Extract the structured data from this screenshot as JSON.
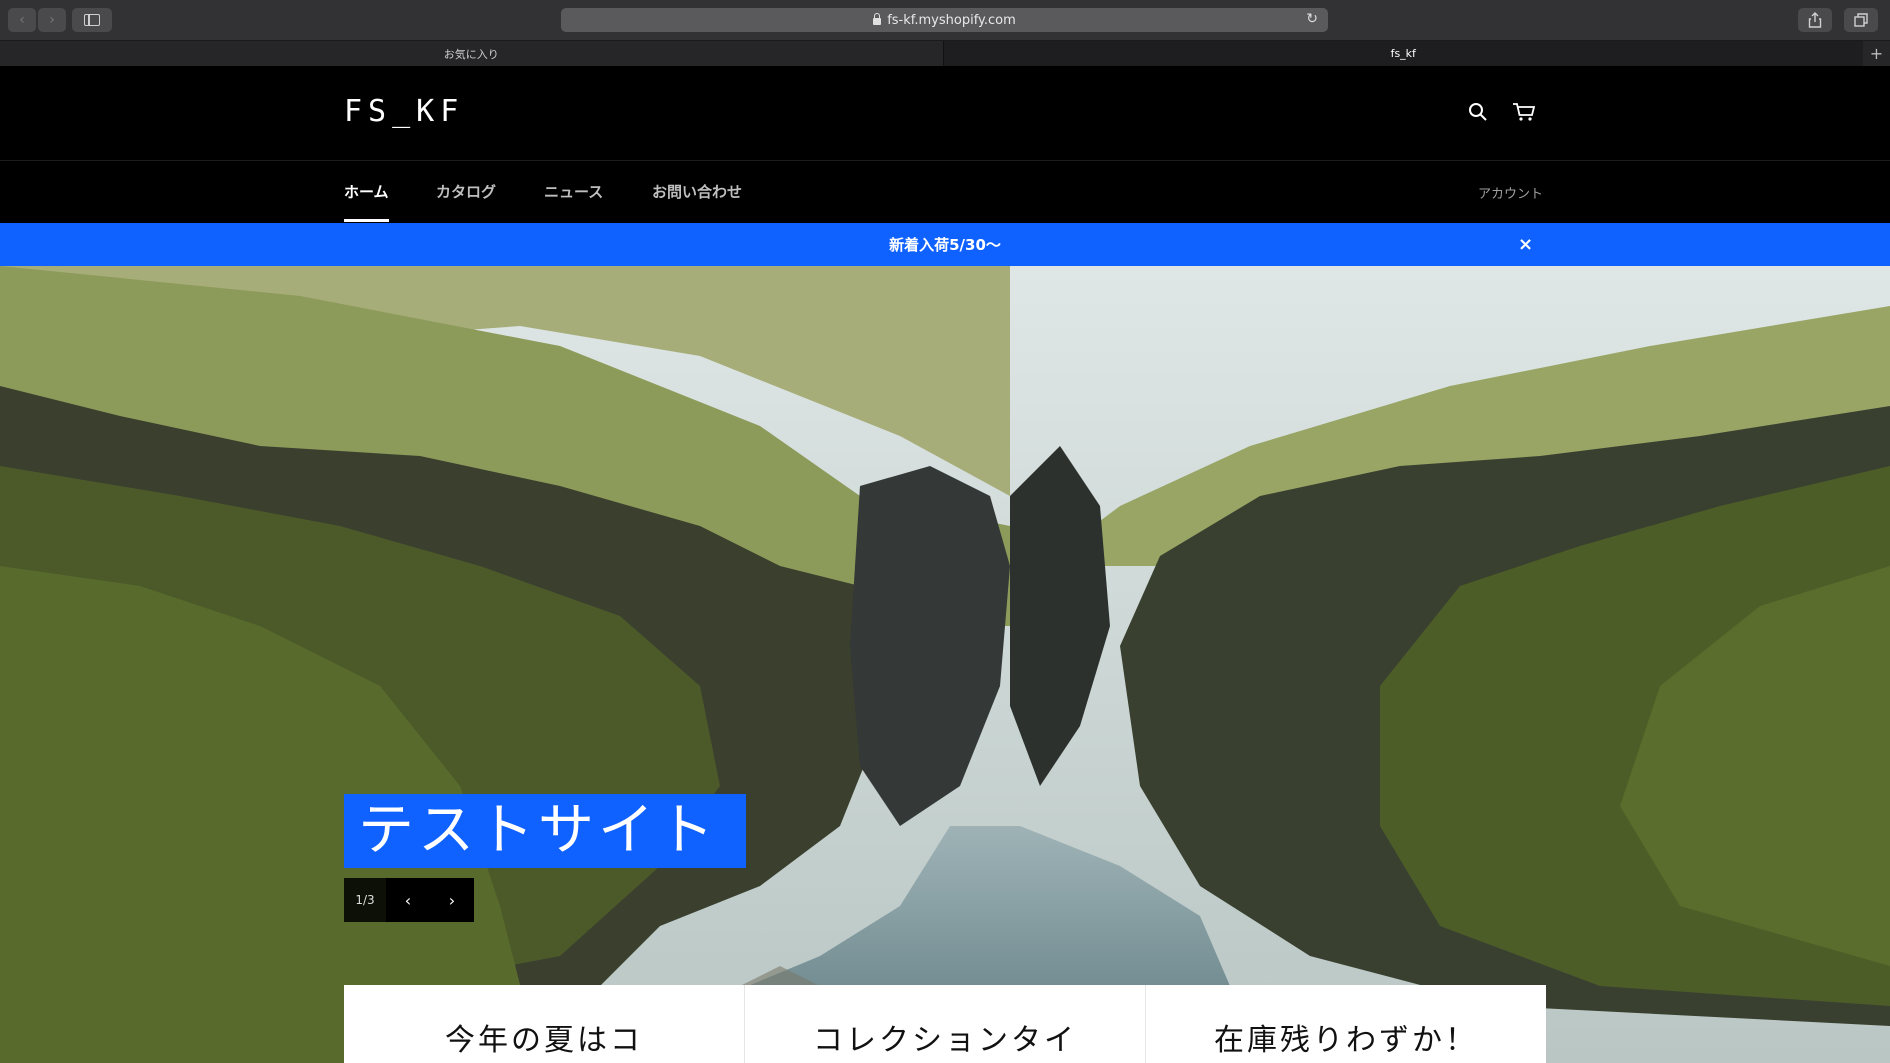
{
  "browser": {
    "url": "fs-kf.myshopify.com",
    "tabs": [
      {
        "label": "お気に入り"
      },
      {
        "label": "fs_kf"
      }
    ],
    "back_glyph": "‹",
    "forward_glyph": "›",
    "reload_glyph": "↻",
    "newtab_glyph": "+"
  },
  "header": {
    "logo": "FS_KF",
    "icons": [
      "search-icon",
      "cart-icon"
    ]
  },
  "nav": {
    "items": [
      {
        "label": "ホーム"
      },
      {
        "label": "カタログ"
      },
      {
        "label": "ニュース"
      },
      {
        "label": "お問い合わせ"
      }
    ],
    "account": "アカウント"
  },
  "announcement": {
    "text": "新着入荷5/30〜",
    "close_glyph": "×",
    "color": "#0f62ff"
  },
  "hero": {
    "title": "テストサイト",
    "counter": "1/3",
    "prev_glyph": "‹",
    "next_glyph": "›"
  },
  "cards": [
    {
      "title": "今年の夏はコ"
    },
    {
      "title": "コレクションタイ"
    },
    {
      "title": "在庫残りわずか！"
    }
  ]
}
